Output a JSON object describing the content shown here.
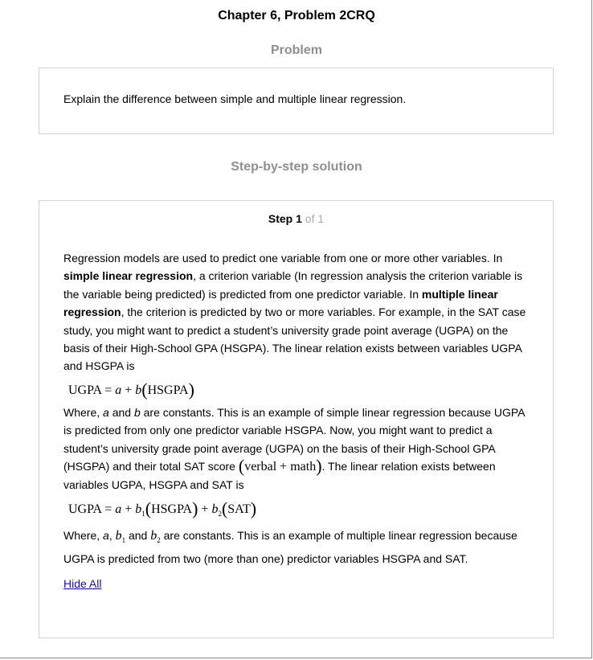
{
  "header": {
    "title": "Chapter 6, Problem 2CRQ"
  },
  "problem": {
    "heading": "Problem",
    "text": "Explain the difference between simple and multiple linear regression."
  },
  "solution": {
    "heading": "Step-by-step solution",
    "step_word": "Step",
    "step_number": "1",
    "step_total": "of 1",
    "p1": [
      "Regression models are used to predict one variable from one or more other variables. In ",
      "simple linear regression",
      ", a criterion variable (In regression analysis the criterion variable is the variable being predicted) is predicted from one predictor variable. In ",
      "multiple linear regression",
      ", the criterion is predicted by two or more variables. For example, in the SAT case study, you might want to predict a student’s university grade point average (UGPA) on the basis of their High-School GPA (HSGPA). The linear relation exists between variables UGPA and HSGPA is"
    ],
    "eq1": {
      "lhs": "UGPA = ",
      "a": "a",
      "plus": " + ",
      "b": "b",
      "open": "(",
      "var": "HSGPA",
      "close": ")"
    },
    "p2": [
      "Where, ",
      "a",
      " and ",
      "b",
      " are constants. This is an example of simple linear regression because UGPA is predicted from only one predictor variable HSGPA. Now, you might want to predict a student’s university grade point average (UGPA) on the basis of their High-School GPA (HSGPA) and their total SAT score ",
      ". The linear relation exists between variables UGPA, HSGPA and SAT is"
    ],
    "inline_expr": {
      "open": "(",
      "text": "verbal + math",
      "close": ")"
    },
    "eq2": {
      "lhs": "UGPA = ",
      "a": "a",
      "plus1": " + ",
      "b1": "b",
      "sub1": "1",
      "open1": "(",
      "var1": "HSGPA",
      "close1": ")",
      "plus2": " + ",
      "b2": "b",
      "sub2": "2",
      "open2": "(",
      "var2": "SAT",
      "close2": ")"
    },
    "p3": [
      "Where, ",
      "a",
      ",  ",
      "b",
      "1",
      " and  ",
      "b",
      "2",
      " are constants. This is an example of multiple linear regression because UGPA is predicted from two (more than one) predictor variables HSGPA and SAT."
    ],
    "hide_all": "Hide All"
  }
}
